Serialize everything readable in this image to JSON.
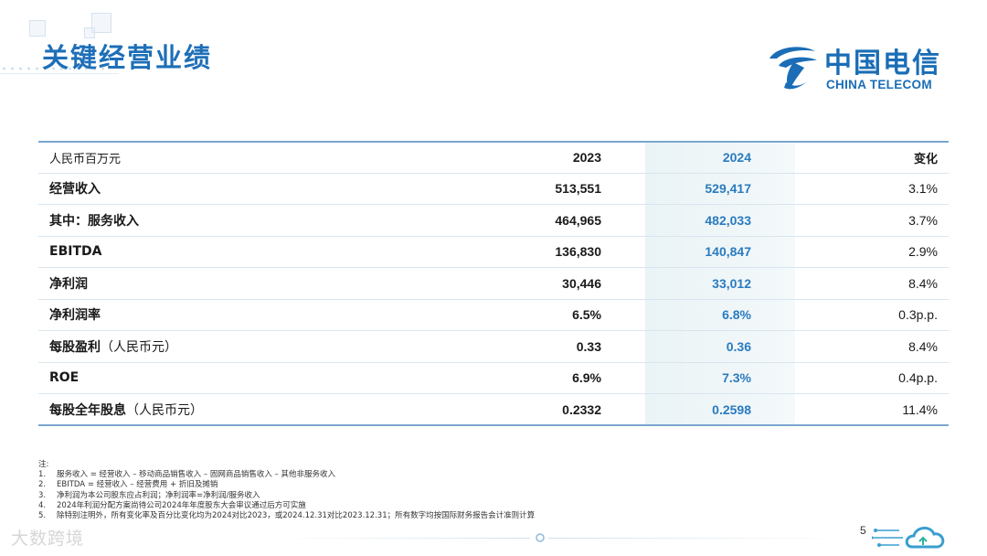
{
  "header": {
    "title": "关键经营业绩"
  },
  "logo": {
    "name_cn": "中国电信",
    "name_en": "CHINA TELECOM",
    "brand_color": "#1a6db6"
  },
  "table": {
    "columns": {
      "label": "人民币百万元",
      "y2023": "2023",
      "y2024": "2024",
      "change": "变化"
    },
    "rows": [
      {
        "label": "经营收入",
        "sub": "",
        "y2023": "513,551",
        "y2024": "529,417",
        "change": "3.1%"
      },
      {
        "label": "其中：服务收入",
        "sub": "",
        "y2023": "464,965",
        "y2024": "482,033",
        "change": "3.7%"
      },
      {
        "label": "EBITDA",
        "sub": "",
        "y2023": "136,830",
        "y2024": "140,847",
        "change": "2.9%"
      },
      {
        "label": "净利润",
        "sub": "",
        "y2023": "30,446",
        "y2024": "33,012",
        "change": "8.4%"
      },
      {
        "label": "净利润率",
        "sub": "",
        "y2023": "6.5%",
        "y2024": "6.8%",
        "change": "0.3p.p."
      },
      {
        "label": "每股盈利",
        "sub": "（人民币元）",
        "y2023": "0.33",
        "y2024": "0.36",
        "change": "8.4%"
      },
      {
        "label": "ROE",
        "sub": "",
        "y2023": "6.9%",
        "y2024": "7.3%",
        "change": "0.4p.p."
      },
      {
        "label": "每股全年股息",
        "sub": "（人民币元）",
        "y2023": "0.2332",
        "y2024": "0.2598",
        "change": "11.4%"
      }
    ],
    "highlight_color": "#2a7bbf"
  },
  "notes": {
    "heading": "注:",
    "items": [
      {
        "num": "1.",
        "text": "服务收入 = 经营收入 – 移动商品销售收入 – 固网商品销售收入 – 其他非服务收入"
      },
      {
        "num": "2.",
        "text": "EBITDA = 经营收入 – 经营费用 + 折旧及摊销"
      },
      {
        "num": "3.",
        "text": "净利润为本公司股东应占利润；净利润率=净利润/服务收入"
      },
      {
        "num": "4.",
        "text": "2024年利润分配方案尚待公司2024年年度股东大会审议通过后方可实施"
      },
      {
        "num": "5.",
        "text": "除特别注明外，所有变化率及百分比变化均为2024对比2023，或2024.12.31对比2023.12.31；所有数字均按国际财务报告会计准则计算"
      }
    ]
  },
  "footer": {
    "page_number": "5",
    "watermark": "大数跨境"
  }
}
